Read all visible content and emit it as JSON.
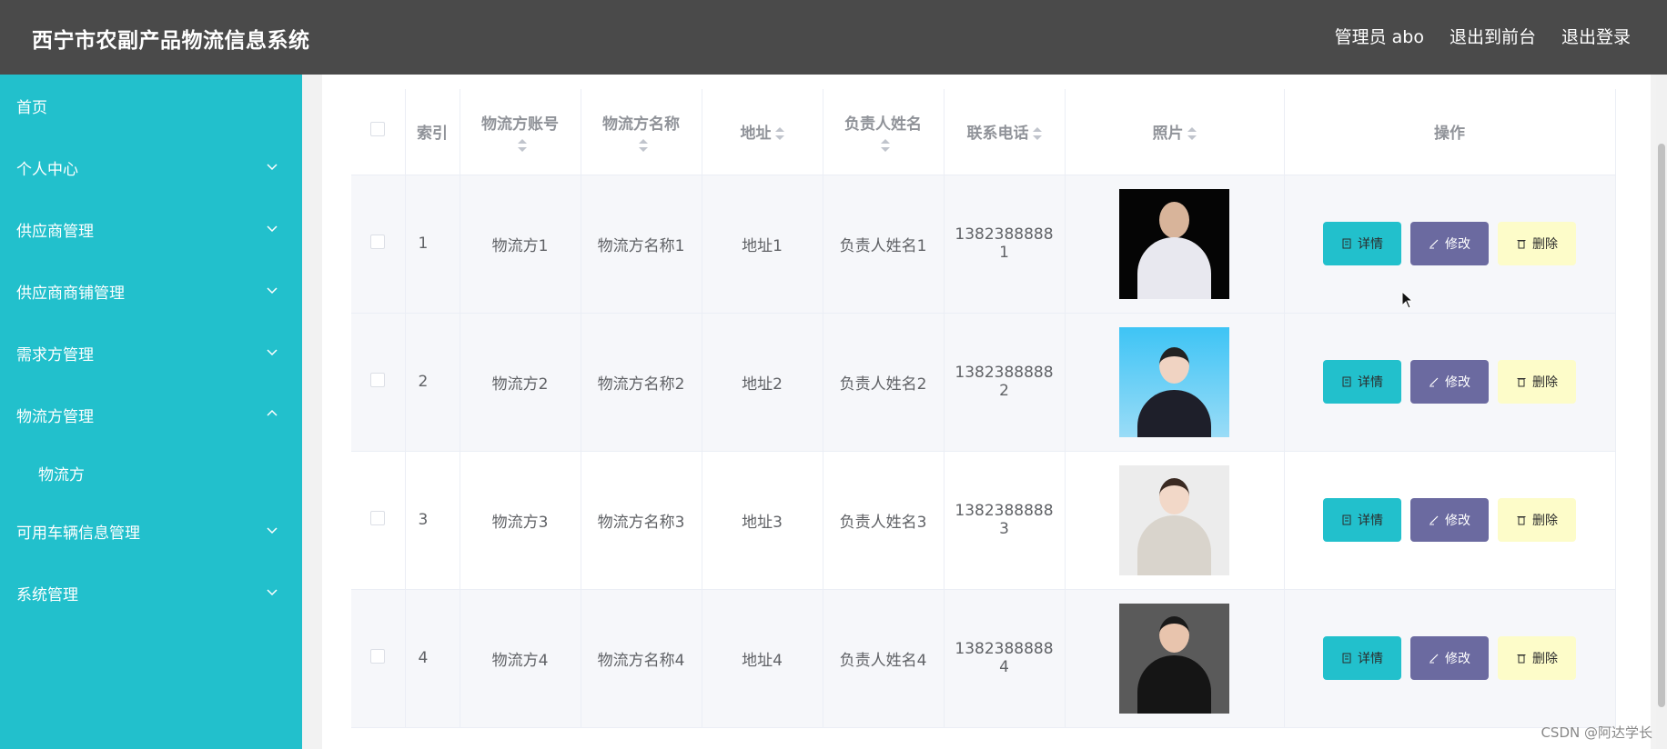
{
  "header": {
    "title": "西宁市农副产品物流信息系统",
    "admin": "管理员 abo",
    "to_front": "退出到前台",
    "logout": "退出登录"
  },
  "sidebar": {
    "items": [
      {
        "label": "首页"
      },
      {
        "label": "个人中心"
      },
      {
        "label": "供应商管理"
      },
      {
        "label": "供应商商铺管理"
      },
      {
        "label": "需求方管理"
      },
      {
        "label": "物流方管理"
      },
      {
        "label": "可用车辆信息管理"
      },
      {
        "label": "系统管理"
      }
    ],
    "sub_item": "物流方"
  },
  "table": {
    "headers": {
      "index": "索引",
      "account": "物流方账号",
      "name": "物流方名称",
      "address": "地址",
      "contact": "负责人姓名",
      "phone": "联系电话",
      "photo": "照片",
      "actions": "操作"
    },
    "rows": [
      {
        "index": "1",
        "account": "物流方1",
        "name": "物流方名称1",
        "address": "地址1",
        "contact": "负责人姓名1",
        "phone_a": "1382388888",
        "phone_b": "1"
      },
      {
        "index": "2",
        "account": "物流方2",
        "name": "物流方名称2",
        "address": "地址2",
        "contact": "负责人姓名2",
        "phone_a": "1382388888",
        "phone_b": "2"
      },
      {
        "index": "3",
        "account": "物流方3",
        "name": "物流方名称3",
        "address": "地址3",
        "contact": "负责人姓名3",
        "phone_a": "1382388888",
        "phone_b": "3"
      },
      {
        "index": "4",
        "account": "物流方4",
        "name": "物流方名称4",
        "address": "地址4",
        "contact": "负责人姓名4",
        "phone_a": "1382388888",
        "phone_b": "4"
      }
    ],
    "buttons": {
      "detail": "详情",
      "edit": "修改",
      "delete": "删除"
    }
  },
  "colors": {
    "header_bg": "#4a4a4a",
    "sidebar_bg": "#22c0cc",
    "detail_btn": "#22c0cc",
    "edit_btn": "#6b6aa0",
    "delete_btn": "#fdfcc9"
  },
  "watermark": "CSDN @阿达学长"
}
